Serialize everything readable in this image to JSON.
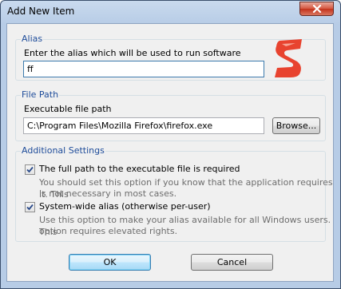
{
  "window": {
    "title": "Add New Item"
  },
  "alias_group": {
    "legend": "Alias",
    "label": "Enter the alias which will be used to run software",
    "value": "ff"
  },
  "path_group": {
    "legend": "File Path",
    "label": "Executable file path",
    "value": "C:\\Program Files\\Mozilla Firefox\\firefox.exe",
    "browse_label": "Browse..."
  },
  "settings_group": {
    "legend": "Additional Settings",
    "option1": {
      "label": "The full path to the executable file is required",
      "checked": true,
      "desc_line1": "You should set this option if you know that the application requires it. This",
      "desc_line2": "is not necessary in most cases."
    },
    "option2": {
      "label": "System-wide alias (otherwise per-user)",
      "checked": true,
      "desc_line1": "Use this option to make your alias available for all Windows users. This",
      "desc_line2": "option requires elevated rights."
    }
  },
  "buttons": {
    "ok_label": "OK",
    "cancel_label": "Cancel"
  },
  "icons": {
    "logo": "app-logo-s-icon",
    "close": "close-icon",
    "check": "checkmark-icon"
  },
  "colors": {
    "logo_red": "#e8432f",
    "legend_blue": "#1e4c9a",
    "close_red": "#c3321b"
  }
}
